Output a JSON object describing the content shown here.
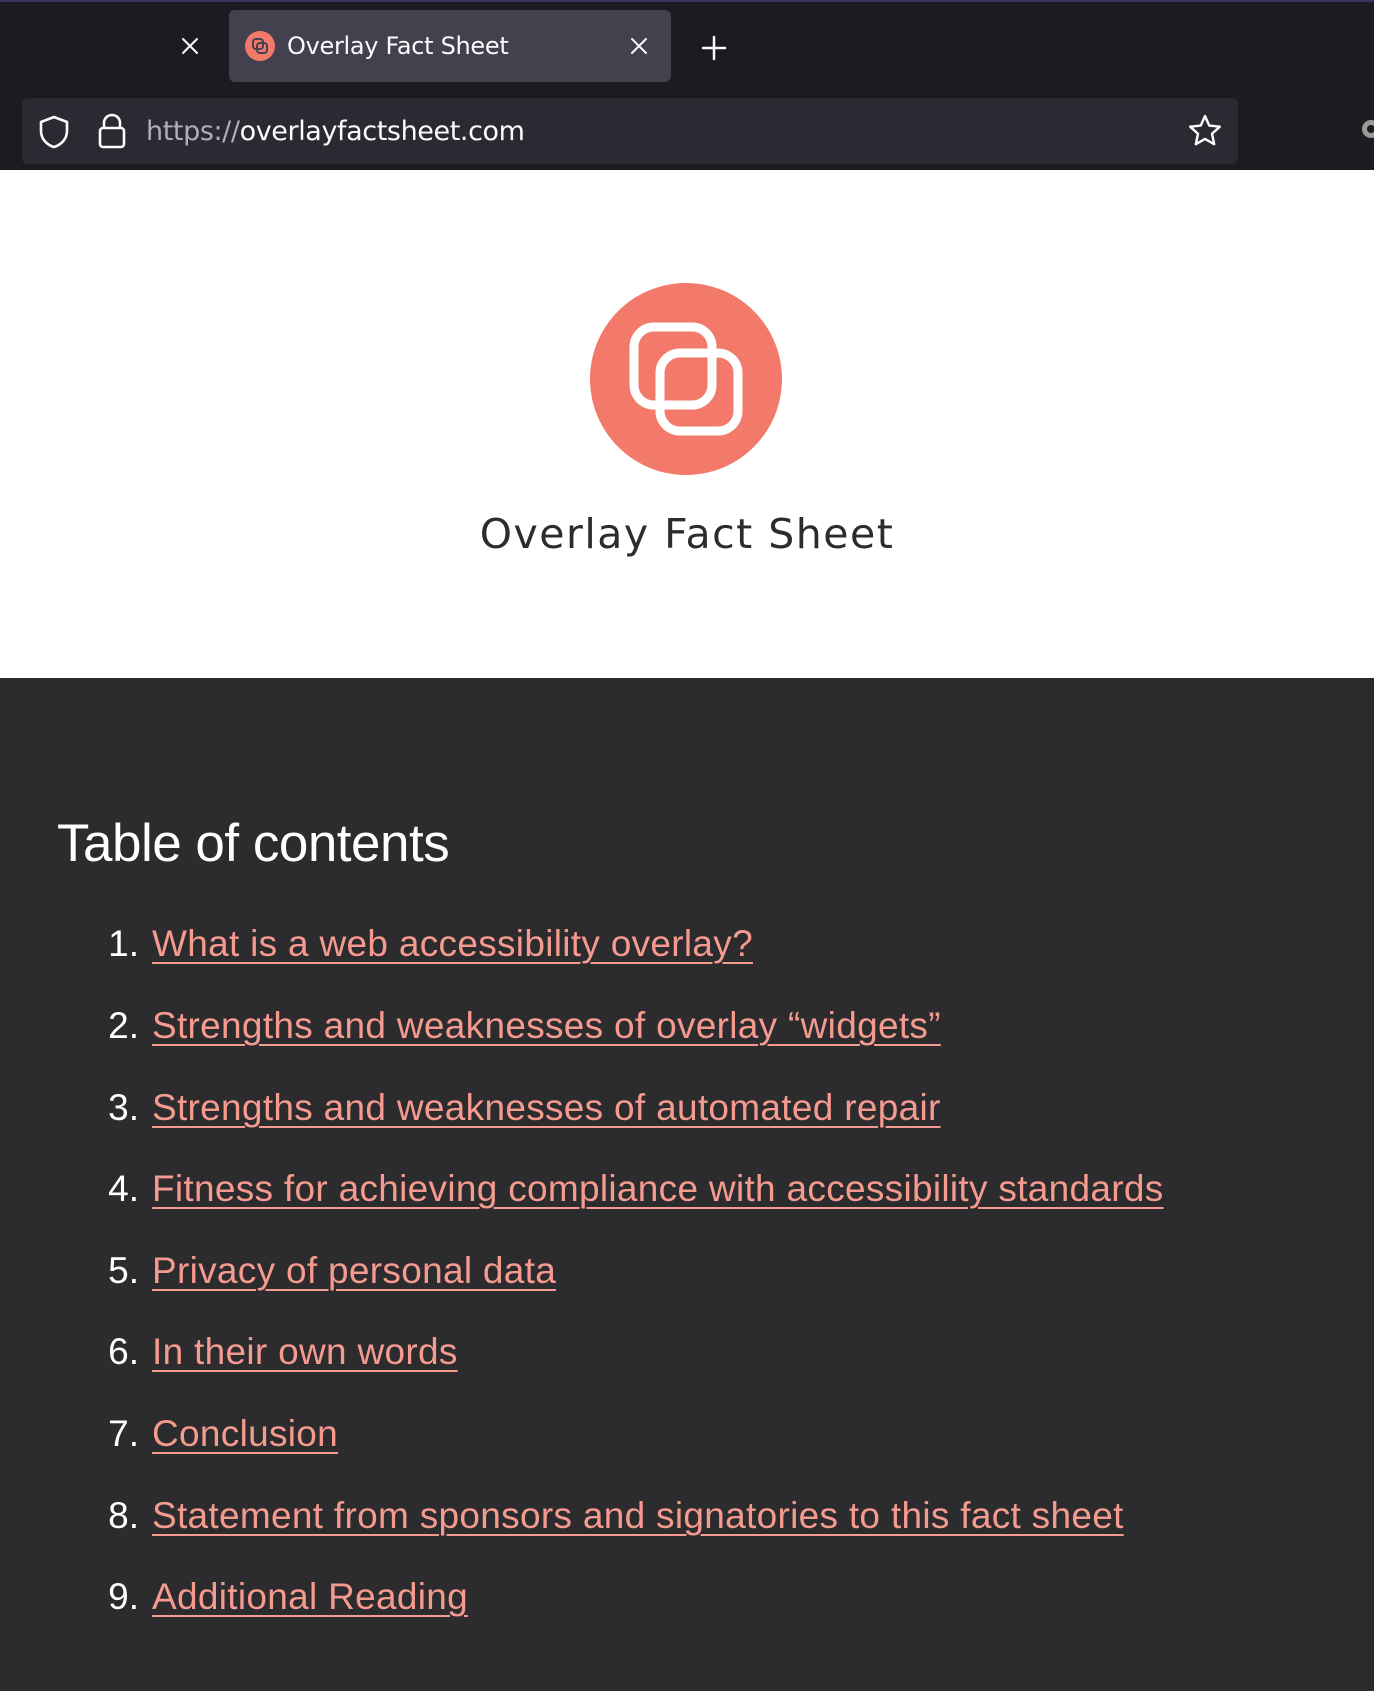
{
  "browser": {
    "tabs": [
      {
        "title": "",
        "active": false
      },
      {
        "title": "Overlay Fact Sheet",
        "active": true
      }
    ],
    "url_scheme": "https://",
    "url_host": "overlayfactsheet.com"
  },
  "hero": {
    "title": "Overlay Fact Sheet"
  },
  "toc": {
    "heading": "Table of contents",
    "items": [
      {
        "num": "1.",
        "label": "What is a web accessibility overlay?"
      },
      {
        "num": "2.",
        "label": "Strengths and weaknesses of overlay “widgets”"
      },
      {
        "num": "3.",
        "label": "Strengths and weaknesses of automated repair"
      },
      {
        "num": "4.",
        "label": "Fitness for achieving compliance with accessibility standards"
      },
      {
        "num": "5.",
        "label": "Privacy of personal data"
      },
      {
        "num": "6.",
        "label": "In their own words"
      },
      {
        "num": "7.",
        "label": "Conclusion"
      },
      {
        "num": "8.",
        "label": "Statement from sponsors and signatories to this fact sheet"
      },
      {
        "num": "9.",
        "label": "Additional Reading"
      }
    ]
  },
  "colors": {
    "accent": "#f37a6a",
    "link": "#f59a8e",
    "dark_bg": "#2c2b2e",
    "chrome_bg": "#1c1b22"
  }
}
